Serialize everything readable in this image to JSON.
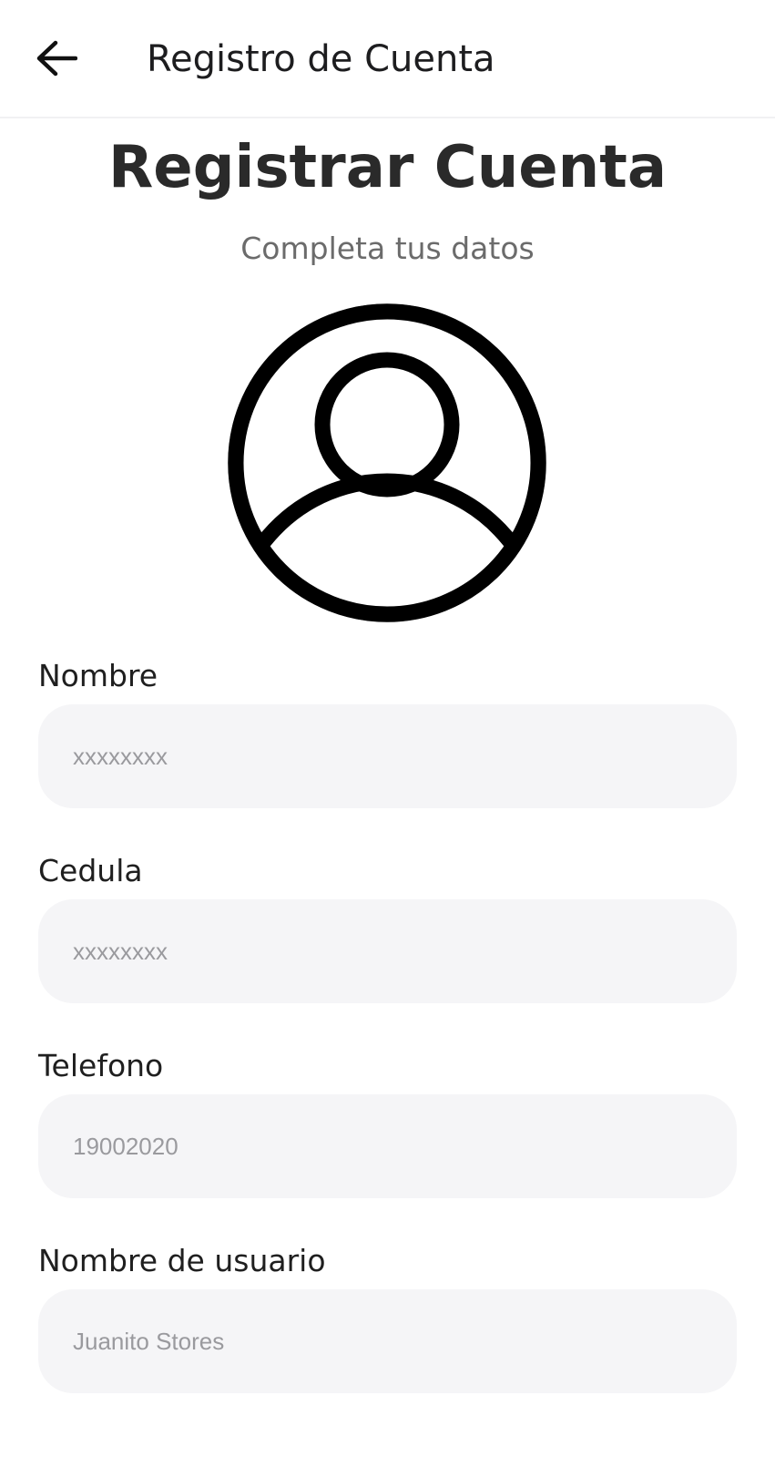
{
  "app_bar": {
    "title": "Registro de Cuenta",
    "back_icon": "arrow-left-icon"
  },
  "header": {
    "heading": "Registrar Cuenta",
    "subtitle": "Completa tus datos"
  },
  "avatar": {
    "icon": "user-circle-icon"
  },
  "form": {
    "fields": [
      {
        "label": "Nombre",
        "placeholder": "xxxxxxxx"
      },
      {
        "label": "Cedula",
        "placeholder": "xxxxxxxx"
      },
      {
        "label": "Telefono",
        "placeholder": "19002020"
      },
      {
        "label": "Nombre de usuario",
        "placeholder": "Juanito Stores"
      }
    ]
  },
  "colors": {
    "input_background": "#f5f5f7",
    "placeholder_text": "#9a9a9e",
    "heading_text": "#2a2a2a",
    "subtitle_text": "#6b6b6b"
  }
}
